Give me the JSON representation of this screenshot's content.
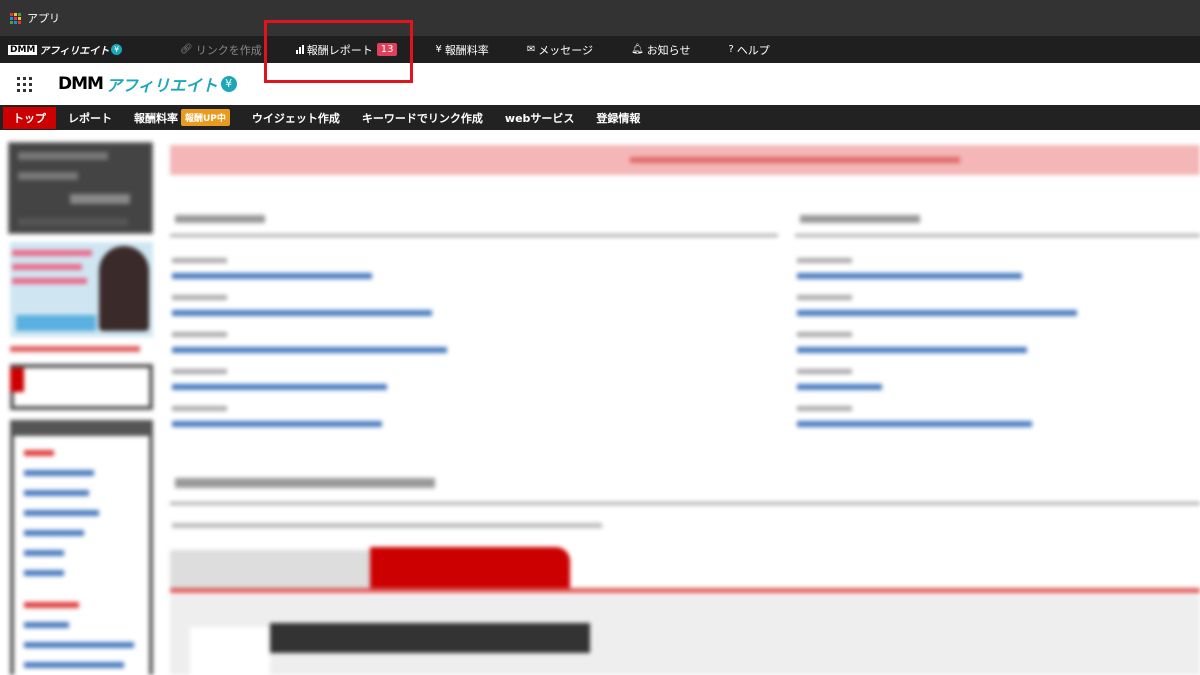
{
  "browser": {
    "app_label": "アプリ",
    "grid_colors": [
      "#e53935",
      "#fbc02d",
      "#43a047",
      "#1e88e5",
      "#e53935",
      "#fbc02d",
      "#43a047",
      "#1e88e5",
      "#e53935"
    ]
  },
  "global_nav": {
    "logo_dmm": "DMM",
    "logo_aff": "アフィリエイト",
    "logo_yen": "¥",
    "items": [
      {
        "label": "リンクを作成",
        "icon": "link-icon"
      },
      {
        "label": "報酬レポート",
        "icon": "bar-chart-icon",
        "badge": "13"
      },
      {
        "label": "報酬料率",
        "icon": "yen-icon"
      },
      {
        "label": "メッセージ",
        "icon": "envelope-icon"
      },
      {
        "label": "お知らせ",
        "icon": "bell-icon"
      },
      {
        "label": "ヘルプ",
        "icon": "question-icon"
      }
    ]
  },
  "header": {
    "logo_dmm": "DMM",
    "logo_aff": "アフィリエイト",
    "logo_yen": "¥"
  },
  "site_nav": {
    "items": [
      {
        "label": "トップ",
        "active": true
      },
      {
        "label": "レポート"
      },
      {
        "label": "報酬料率",
        "badge": "報酬UP中"
      },
      {
        "label": "ウイジェット作成"
      },
      {
        "label": "キーワードでリンク作成"
      },
      {
        "label": "webサービス"
      },
      {
        "label": "登録情報"
      }
    ]
  },
  "colors": {
    "highlight": "#e0141e",
    "brand_teal": "#1ba7b8",
    "active_red": "#cc0000",
    "badge_orange": "#e89b1c",
    "badge_pink": "#e0405a"
  }
}
